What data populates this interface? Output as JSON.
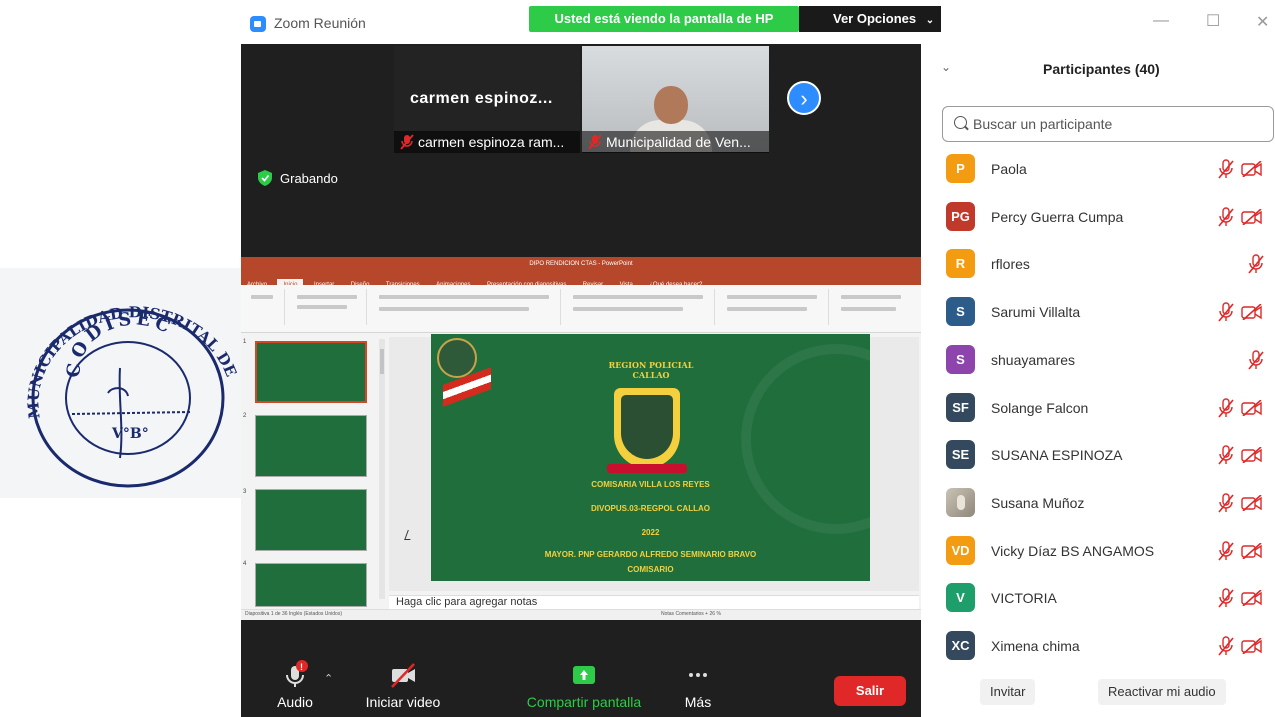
{
  "window": {
    "title": "Zoom Reunión",
    "share_banner": "Usted está viendo la pantalla de HP",
    "view_options": "Ver Opciones"
  },
  "videos": [
    {
      "display_name": "carmen  espinoz...",
      "label": "carmen espinoza ram..."
    },
    {
      "label": "Municipalidad de Ven..."
    }
  ],
  "recording": {
    "label": "Grabando"
  },
  "presentation": {
    "app_title": "DIPO RENDICION CTAS - PowerPoint",
    "menu": [
      "Archivo",
      "Inicio",
      "Insertar",
      "Diseño",
      "Transiciones",
      "Animaciones",
      "Presentación con diapositivas",
      "Revisar",
      "Vista",
      "¿Qué desea hacer?"
    ],
    "slide": {
      "region_line1": "REGION POLICIAL",
      "region_line2": "CALLAO",
      "line1": "COMISARIA VILLA LOS REYES",
      "line2": "DIVOPUS.03-REGPOL CALLAO",
      "line3": "2022",
      "line4": "MAYOR. PNP  GERARDO ALFREDO SEMINARIO BRAVO",
      "line5": "COMISARIO"
    },
    "notes_placeholder": "Haga clic para agregar notas",
    "status_left": "Diapositiva 1 de 36   Inglés (Estados Unidos)",
    "status_right": "Notas   Comentarios            +  26 %",
    "thumb_numbers": [
      "1",
      "2",
      "3",
      "4"
    ]
  },
  "toolbar": {
    "audio": "Audio",
    "video": "Iniciar video",
    "share": "Compartir pantalla",
    "more": "Más",
    "leave": "Salir"
  },
  "participants": {
    "title": "Participantes (40)",
    "search_placeholder": "Buscar un participante",
    "list": [
      {
        "initials": "P",
        "name": "Paola",
        "color": "#f39c12"
      },
      {
        "initials": "PG",
        "name": "Percy Guerra Cumpa",
        "color": "#c0392b"
      },
      {
        "initials": "R",
        "name": "rflores",
        "color": "#f39c12"
      },
      {
        "initials": "S",
        "name": "Sarumi Villalta",
        "color": "#2c5d8a"
      },
      {
        "initials": "S",
        "name": "shuayamares",
        "color": "#8e44ad"
      },
      {
        "initials": "SF",
        "name": "Solange Falcon",
        "color": "#34495e"
      },
      {
        "initials": "SE",
        "name": "SUSANA ESPINOZA",
        "color": "#34495e"
      },
      {
        "initials": "",
        "name": "Susana Muñoz",
        "color": "#a59d90"
      },
      {
        "initials": "VD",
        "name": "Vicky Díaz BS ANGAMOS",
        "color": "#f39c12"
      },
      {
        "initials": "V",
        "name": "VICTORIA",
        "color": "#1e9e6a"
      },
      {
        "initials": "XC",
        "name": "Ximena chima",
        "color": "#34495e"
      }
    ],
    "invite": "Invitar",
    "unmute_me": "Reactivar mi audio"
  },
  "stamp": {
    "text_top": "MUNICIPALIDAD DISTRITAL DE VENTANILLA",
    "text_inner": "CODISEC",
    "text_vb": "V°B°"
  }
}
